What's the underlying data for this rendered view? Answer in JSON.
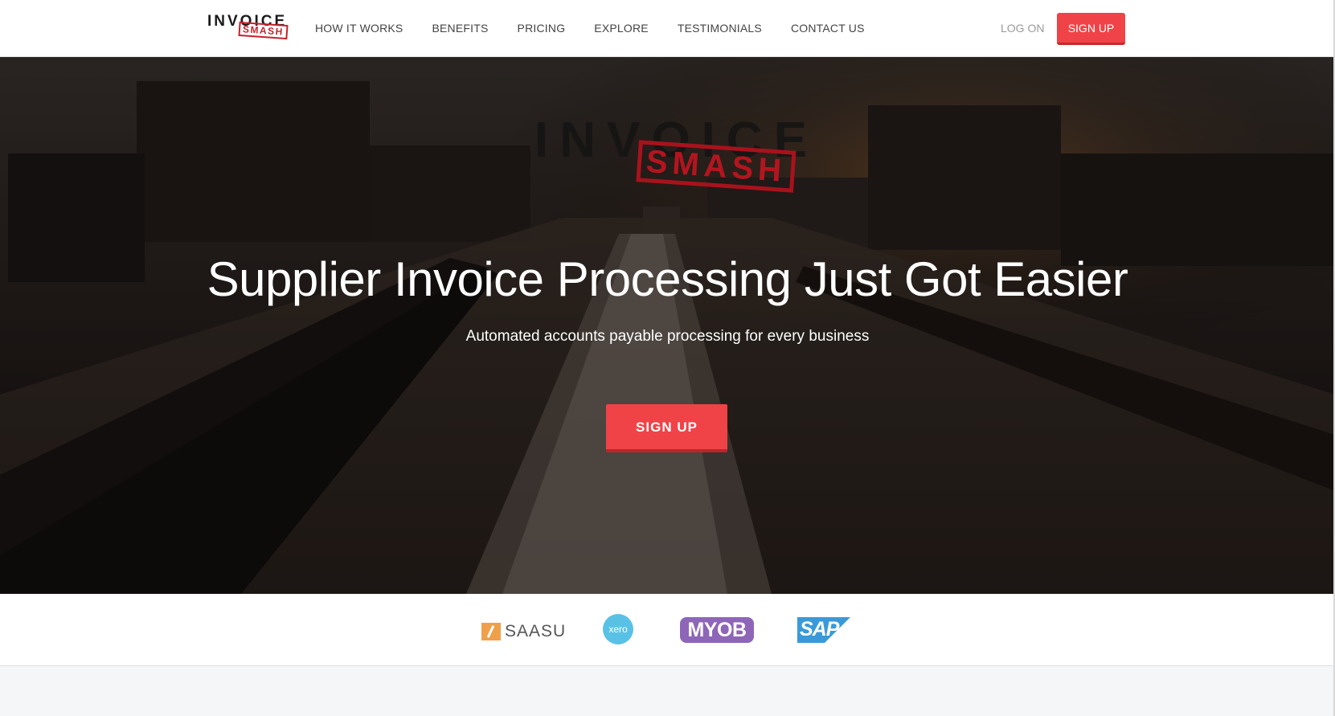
{
  "header": {
    "logo": {
      "word": "INVOICE",
      "stamp": "SMASH"
    },
    "nav": [
      {
        "label": "HOW IT WORKS"
      },
      {
        "label": "BENEFITS"
      },
      {
        "label": "PRICING"
      },
      {
        "label": "EXPLORE"
      },
      {
        "label": "TESTIMONIALS"
      },
      {
        "label": "CONTACT US"
      }
    ],
    "login_label": "LOG ON",
    "signup_label": "SIGN UP"
  },
  "hero": {
    "logo": {
      "word": "INVOICE",
      "stamp": "SMASH"
    },
    "title": "Supplier Invoice Processing Just Got Easier",
    "subtitle": "Automated accounts payable processing for every business",
    "cta_label": "SIGN UP"
  },
  "partners": {
    "saasu": "SAASU",
    "xero": "xero",
    "myob": "MYOB",
    "sap": "SAP"
  },
  "colors": {
    "accent": "#f04347",
    "stamp_red": "#c8202b",
    "hero_bg": "#1b1514"
  }
}
